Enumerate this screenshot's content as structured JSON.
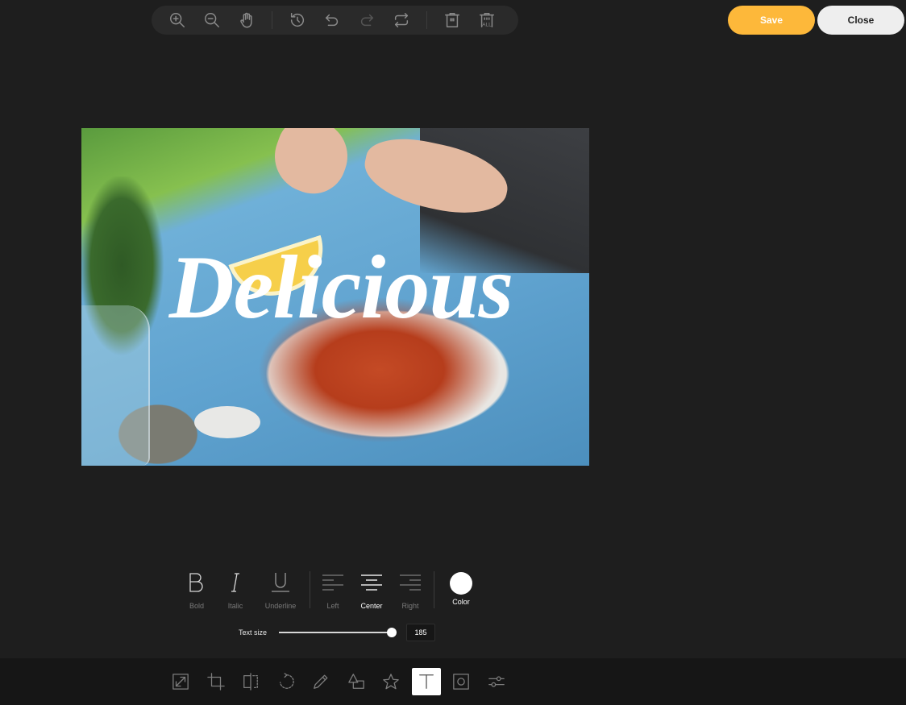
{
  "toolbar": {
    "history_buttons": [
      {
        "name": "zoom-in",
        "icon": "zoom-in-icon",
        "enabled": true
      },
      {
        "name": "zoom-out",
        "icon": "zoom-out-icon",
        "enabled": true
      },
      {
        "name": "pan",
        "icon": "hand-icon",
        "enabled": true
      },
      {
        "name": "history",
        "icon": "history-icon",
        "enabled": true
      },
      {
        "name": "undo",
        "icon": "undo-icon",
        "enabled": true
      },
      {
        "name": "redo",
        "icon": "redo-icon",
        "enabled": false
      },
      {
        "name": "reset",
        "icon": "reset-icon",
        "enabled": true
      },
      {
        "name": "delete",
        "icon": "trash-icon",
        "enabled": true
      },
      {
        "name": "delete-all",
        "icon": "trash-all-icon",
        "enabled": true
      }
    ],
    "delete_all_text": "ALL"
  },
  "actions": {
    "save_label": "Save",
    "close_label": "Close",
    "save_color": "#fdb83a",
    "close_color": "#eeeeee"
  },
  "canvas": {
    "image_description": "Hands picking boiled crayfish from a plate on a blue tablecloth with lemon wedge, herbs in glass vase and bowl of salt",
    "overlay_text": "Delicious",
    "overlay_text_color": "#ffffff"
  },
  "text_panel": {
    "format_buttons": [
      {
        "label": "Bold",
        "icon": "bold-icon",
        "active": false
      },
      {
        "label": "Italic",
        "icon": "italic-icon",
        "active": false
      },
      {
        "label": "Underline",
        "icon": "underline-icon",
        "active": false
      }
    ],
    "align_buttons": [
      {
        "label": "Left",
        "icon": "align-left-icon",
        "active": false
      },
      {
        "label": "Center",
        "icon": "align-center-icon",
        "active": true
      },
      {
        "label": "Right",
        "icon": "align-right-icon",
        "active": false
      }
    ],
    "color": {
      "label": "Color",
      "value": "#ffffff"
    },
    "text_size": {
      "label": "Text size",
      "value": "185",
      "fraction": 0.97
    }
  },
  "tools": [
    {
      "name": "resize",
      "icon": "resize-icon",
      "active": false
    },
    {
      "name": "crop",
      "icon": "crop-icon",
      "active": false
    },
    {
      "name": "flip",
      "icon": "flip-icon",
      "active": false
    },
    {
      "name": "rotate",
      "icon": "rotate-icon",
      "active": false
    },
    {
      "name": "draw",
      "icon": "pencil-icon",
      "active": false
    },
    {
      "name": "shape",
      "icon": "shape-icon",
      "active": false
    },
    {
      "name": "icon",
      "icon": "star-icon",
      "active": false
    },
    {
      "name": "text",
      "icon": "text-icon",
      "active": true
    },
    {
      "name": "mask",
      "icon": "mask-icon",
      "active": false
    },
    {
      "name": "filter",
      "icon": "sliders-icon",
      "active": false
    }
  ]
}
